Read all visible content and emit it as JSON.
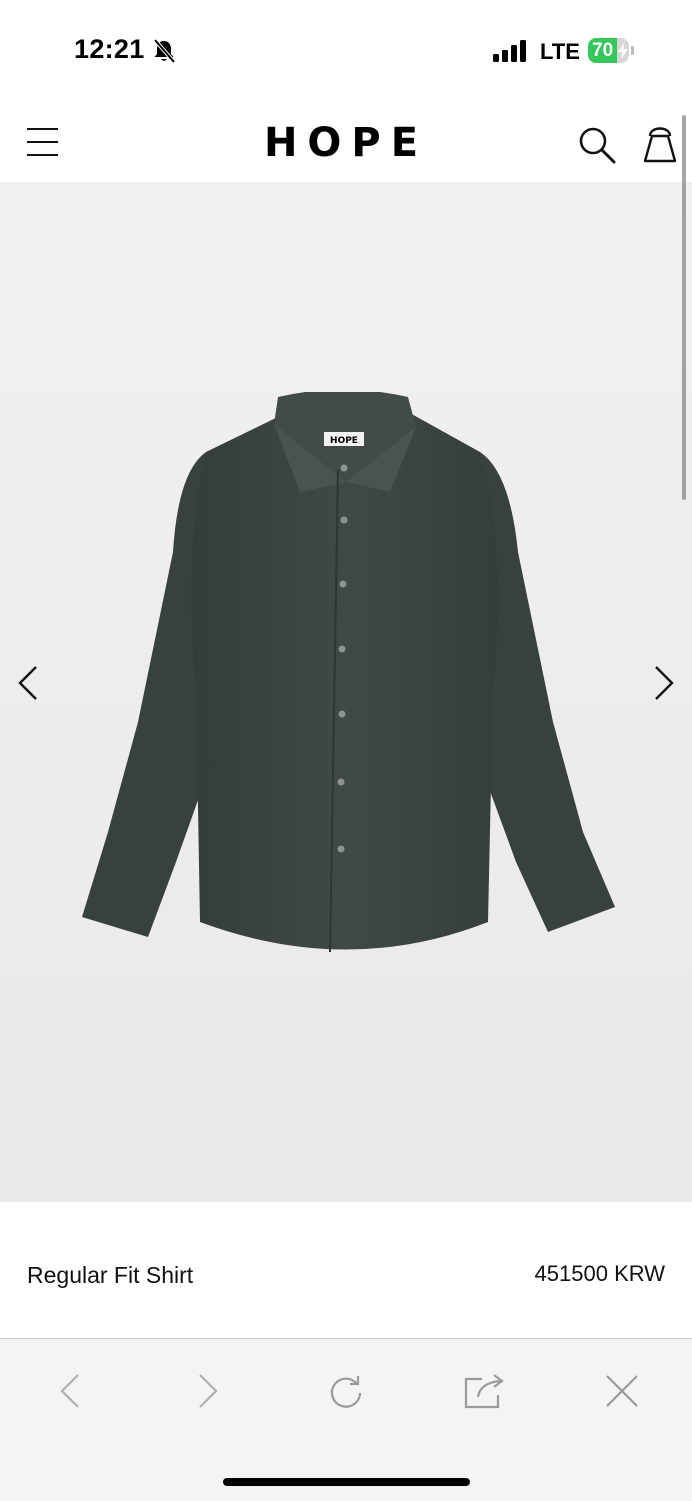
{
  "status_bar": {
    "time": "12:21",
    "network": "LTE",
    "battery_percent": 70,
    "battery_label": "70",
    "icons": [
      "bell-slash-icon",
      "cellular-signal-icon",
      "battery-charging-icon"
    ]
  },
  "header": {
    "logo": "HOPE",
    "icons": [
      "hamburger-menu-icon",
      "search-icon",
      "shopping-bag-icon"
    ]
  },
  "gallery": {
    "image": "dark green button-up shirt",
    "shirt_label": "HOPE",
    "icons": [
      "chevron-left-icon",
      "chevron-right-icon"
    ]
  },
  "product": {
    "name": "Regular Fit Shirt",
    "price": "451500 KRW"
  },
  "browser_toolbar": {
    "icons": [
      "back-icon",
      "forward-icon",
      "reload-icon",
      "share-icon",
      "close-icon"
    ]
  },
  "colors": {
    "shirt": "#3c4540",
    "gallery_bg": "#ebebeb",
    "battery_green": "#34c759",
    "toolbar_icon": "#9a9a9a"
  }
}
